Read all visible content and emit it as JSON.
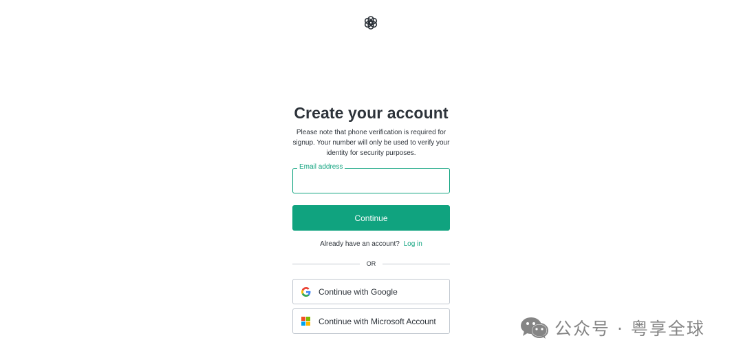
{
  "header": {
    "logo_icon": "openai-logo-icon"
  },
  "signup": {
    "title": "Create your account",
    "subtitle": "Please note that phone verification is required for signup. Your number will only be used to verify your identity for security purposes.",
    "email": {
      "label": "Email address",
      "value": "",
      "placeholder": ""
    },
    "continue_label": "Continue",
    "login_prompt": "Already have an account?",
    "login_link": "Log in",
    "divider_text": "OR",
    "google_label": "Continue with Google",
    "google_icon": "google-icon",
    "microsoft_label": "Continue with Microsoft Account",
    "microsoft_icon": "microsoft-icon"
  },
  "watermark": {
    "icon": "wechat-icon",
    "text": "公众号 · 粤享全球"
  },
  "colors": {
    "accent": "#10a37f",
    "text": "#2d333a",
    "border": "#c2c8d0"
  }
}
